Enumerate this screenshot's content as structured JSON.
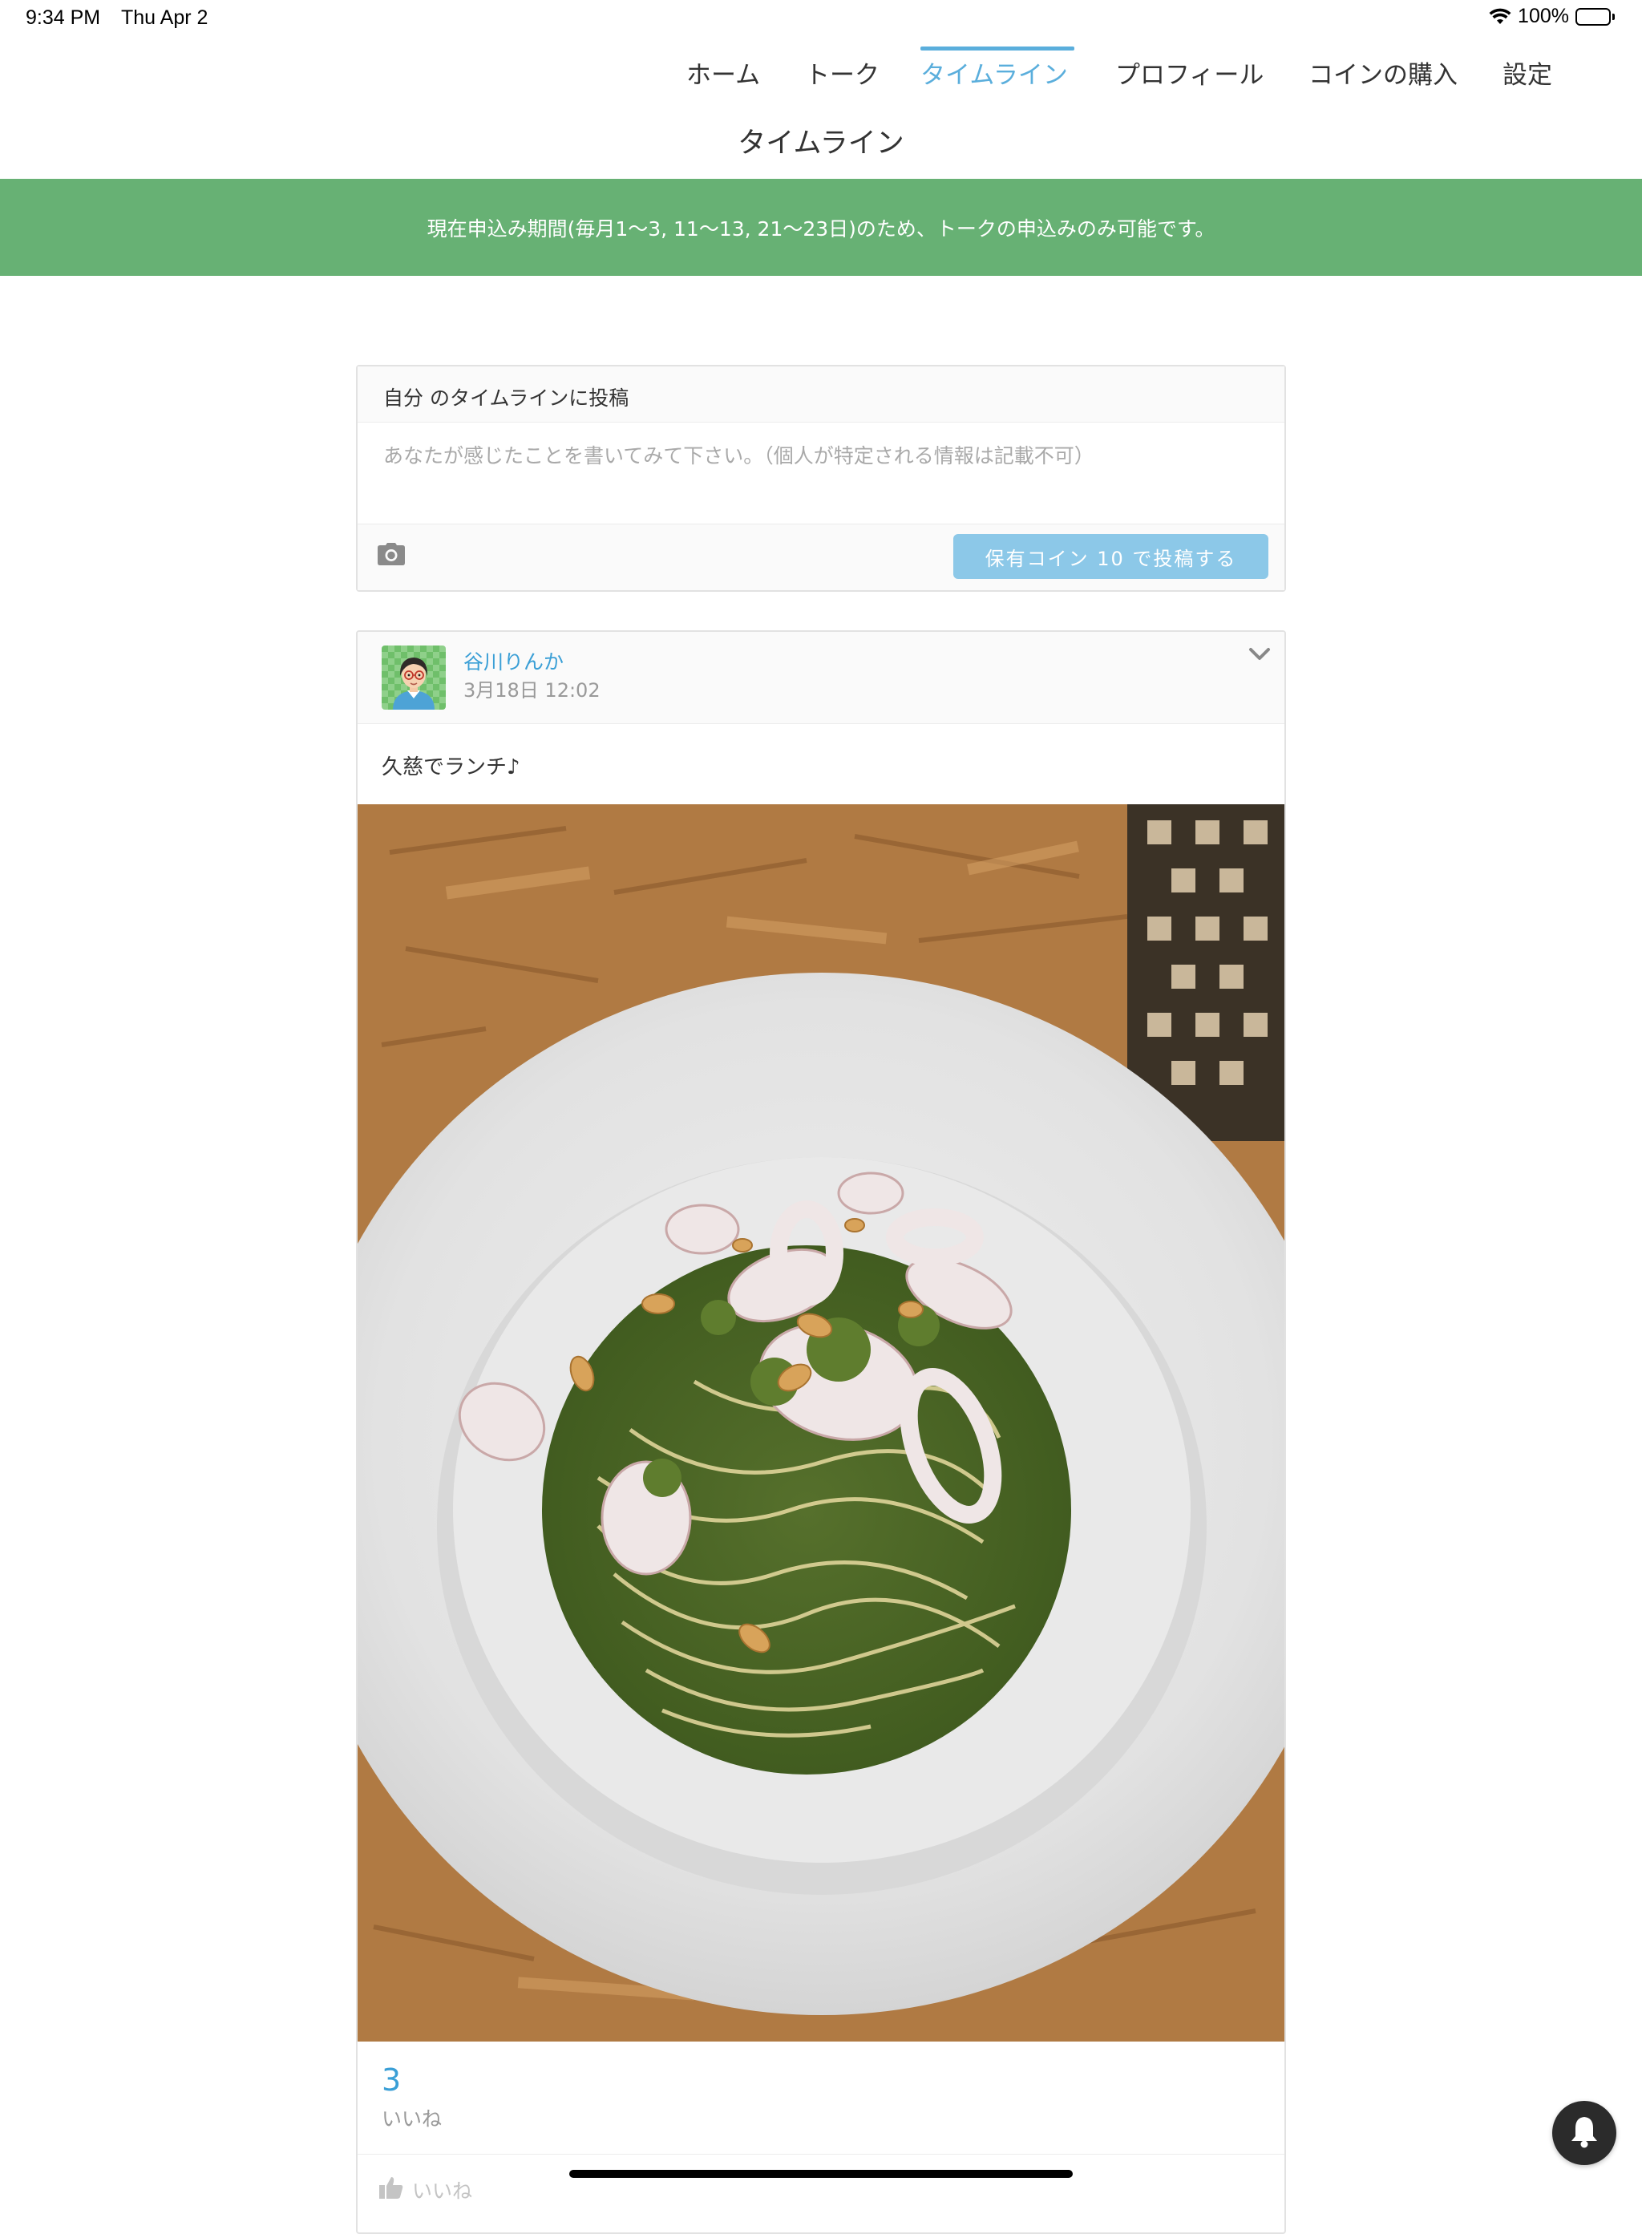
{
  "status_bar": {
    "time": "9:34 PM",
    "date": "Thu Apr 2",
    "battery": "100%"
  },
  "nav": {
    "items": [
      "ホーム",
      "トーク",
      "タイムライン",
      "プロフィール",
      "コインの購入",
      "設定"
    ],
    "active": "タイムライン",
    "accent_color": "#5aaedc"
  },
  "page_title": "タイムライン",
  "banner": {
    "text": "現在申込み期間(毎月1〜3, 11〜13, 21〜23日)のため、トークの申込みのみ可能です。",
    "color": "#67b174"
  },
  "compose": {
    "header": "自分 のタイムラインに投稿",
    "placeholder": "あなたが感じたことを書いてみて下さい。（個人が特定される情報は記載不可）",
    "camera_icon": "camera-icon",
    "post_button": "保有コイン 10 で投稿する"
  },
  "post": {
    "author": "谷川りんか",
    "date": "3月18日 12:02",
    "text": "久慈でランチ♪",
    "photo_icon": "pasta-photo",
    "like_count": "3",
    "like_label": "いいね",
    "like_button": "いいね"
  },
  "floating": {
    "bell_icon": "bell-icon"
  }
}
